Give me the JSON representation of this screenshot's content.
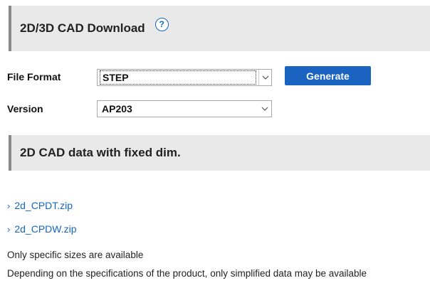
{
  "download_section": {
    "title": "2D/3D CAD Download",
    "help_symbol": "?"
  },
  "form": {
    "file_format_label": "File Format",
    "file_format_value": "STEP",
    "version_label": "Version",
    "version_value": "AP203",
    "generate_label": "Generate"
  },
  "fixed_dim_section": {
    "title": "2D CAD data with fixed dim."
  },
  "files": [
    {
      "name": "2d_CPDT.zip"
    },
    {
      "name": "2d_CPDW.zip"
    }
  ],
  "notes": {
    "line1": "Only specific sizes are available",
    "line2": "Depending on the specifications of the product, only simplified data may be available"
  },
  "icons": {
    "help": "help-circle-icon",
    "dropdown": "chevron-down-icon",
    "link": "chevron-right-icon"
  },
  "colors": {
    "accent": "#1a63c0",
    "link": "#1466c4",
    "header_bg": "#e9e9e9",
    "header_border": "#8a8a8a"
  }
}
